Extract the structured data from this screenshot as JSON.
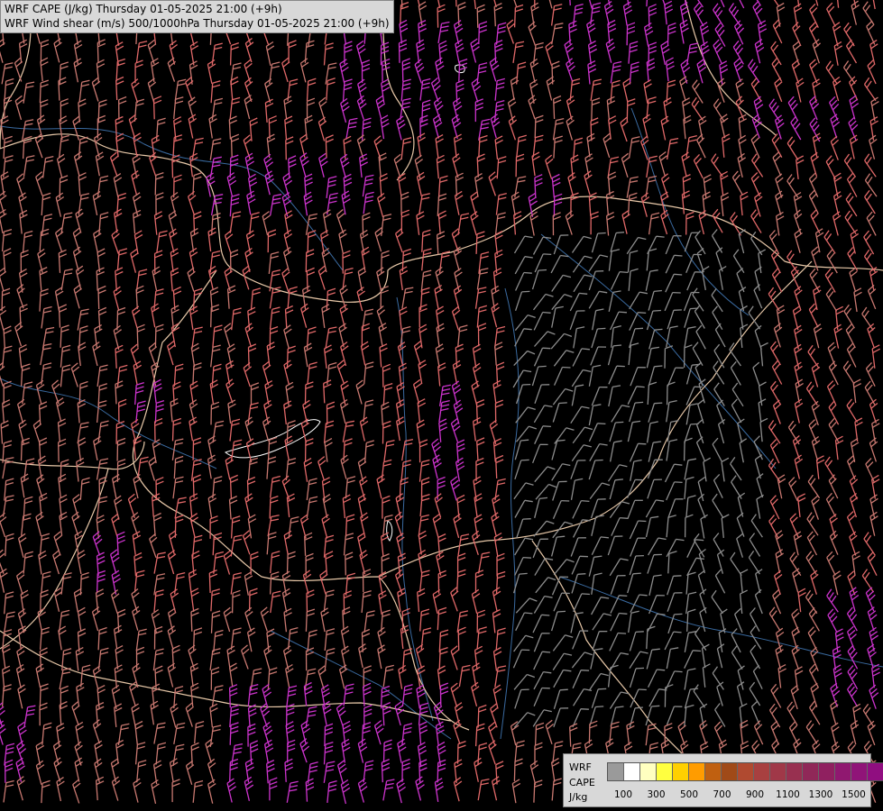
{
  "title": {
    "line1": "WRF CAPE (J/kg) Thursday 01-05-2025 21:00 (+9h)",
    "line2": "WRF Wind shear (m/s) 500/1000hPa Thursday 01-05-2025 21:00 (+9h)"
  },
  "legend": {
    "label_model": "WRF",
    "label_field": "CAPE",
    "label_unit": "J/kg",
    "colors": [
      "#9a9a9a",
      "#ffffff",
      "#ffffc0",
      "#ffff40",
      "#ffd000",
      "#ff9c00",
      "#c06010",
      "#a04a18",
      "#b04a30",
      "#a84040",
      "#a03848",
      "#983050",
      "#902858",
      "#902060",
      "#901870",
      "#901478",
      "#900e80",
      "#a00aa0"
    ],
    "ticks": [
      "100",
      "300",
      "500",
      "700",
      "900",
      "1100",
      "1300",
      "1500"
    ]
  },
  "map": {
    "background": "#000000",
    "border_color": "#e8c8a8",
    "river_color": "#3a6aa0",
    "barb_colors": {
      "low": "#8c8c8c",
      "mid": "#c87870",
      "high": "#e06868",
      "very_high": "#cc33cc"
    }
  }
}
